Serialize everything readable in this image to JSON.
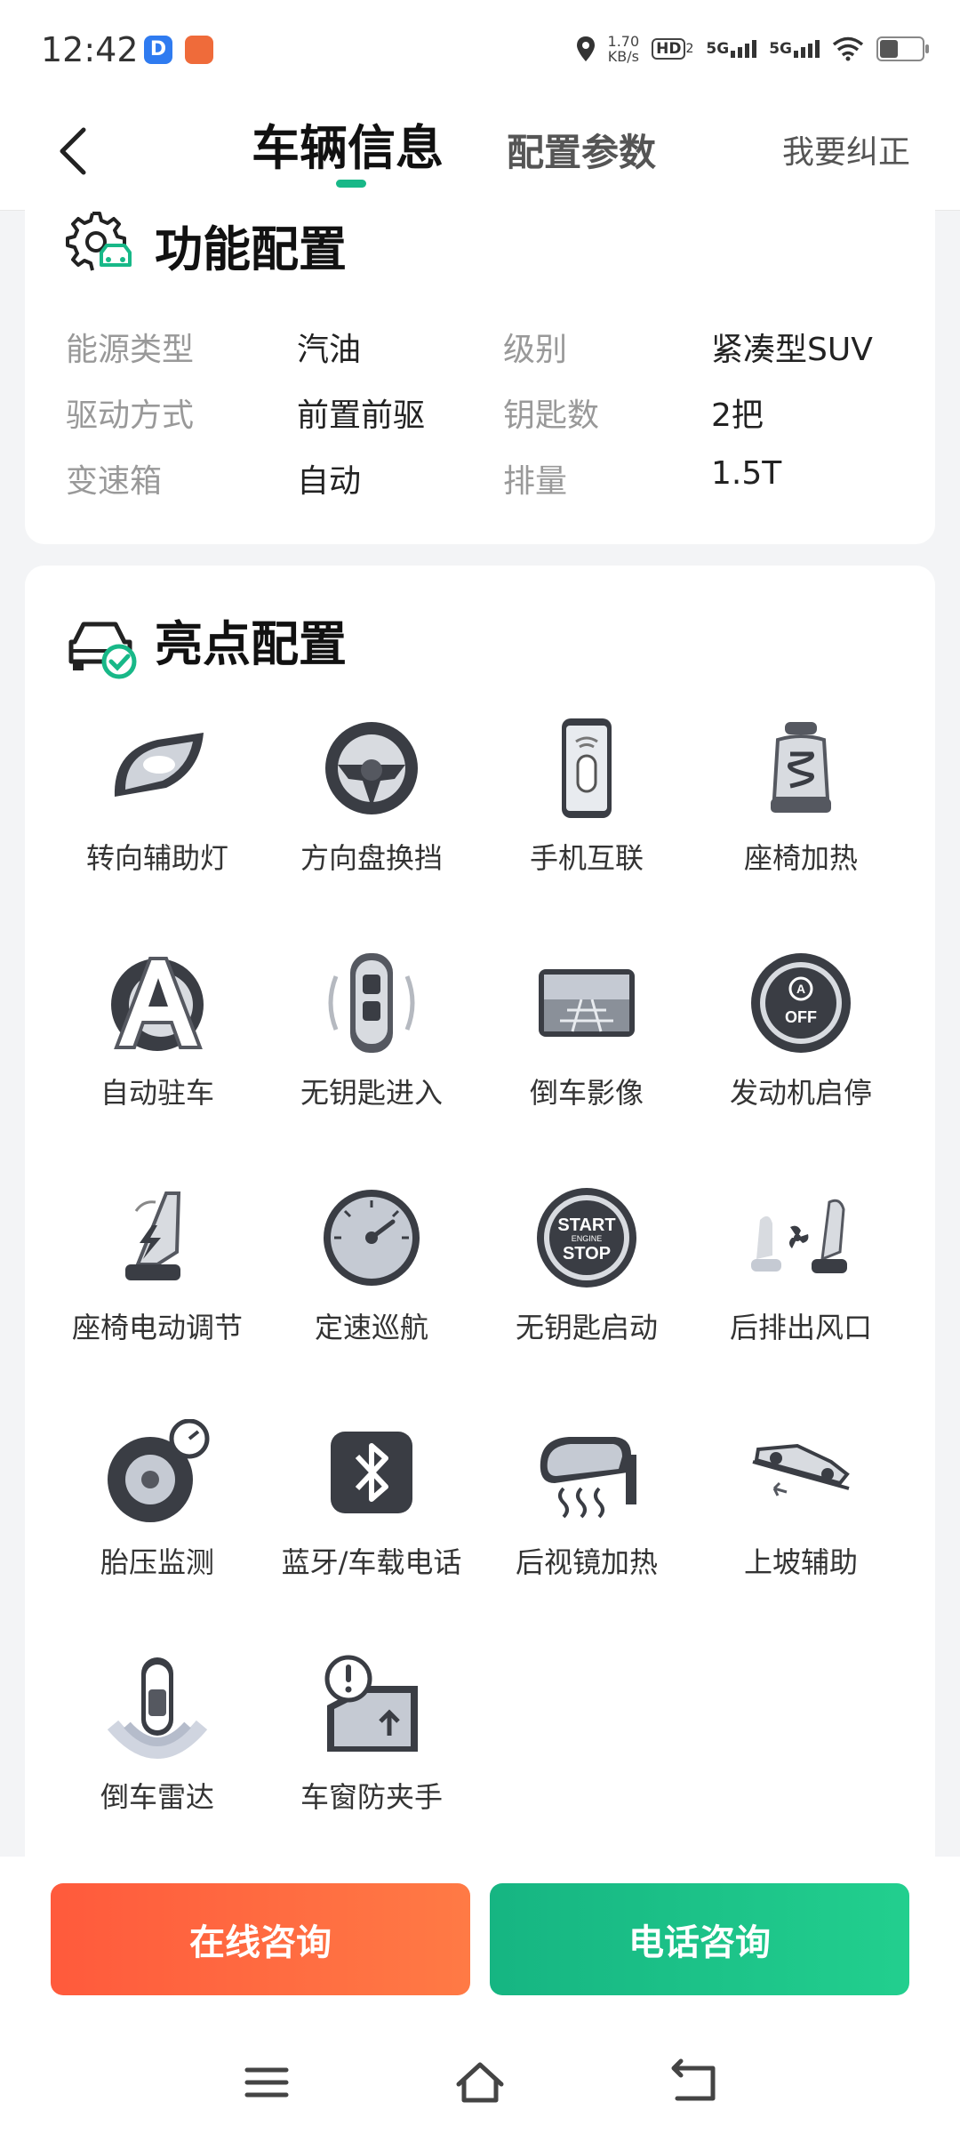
{
  "status_bar": {
    "time": "12:42",
    "speed_value": "1.70",
    "speed_unit": "KB/s",
    "hd_label": "HD",
    "hd_sub": "2",
    "net1": "5G",
    "net2": "5G"
  },
  "nav": {
    "tab_active": "车辆信息",
    "tab_inactive": "配置参数",
    "correct_label": "我要纠正"
  },
  "function_config": {
    "title": "功能配置",
    "rows": [
      {
        "label1": "能源类型",
        "value1": "汽油",
        "label2": "级别",
        "value2": "紧凑型SUV"
      },
      {
        "label1": "驱动方式",
        "value1": "前置前驱",
        "label2": "钥匙数",
        "value2": "2把"
      },
      {
        "label1": "变速箱",
        "value1": "自动",
        "label2": "排量",
        "value2": "1.5T"
      }
    ]
  },
  "highlight_config": {
    "title": "亮点配置",
    "items": [
      {
        "label": "转向辅助灯",
        "icon": "headlight-icon"
      },
      {
        "label": "方向盘换挡",
        "icon": "steering-wheel-icon"
      },
      {
        "label": "手机互联",
        "icon": "phone-link-icon"
      },
      {
        "label": "座椅加热",
        "icon": "seat-heat-icon"
      },
      {
        "label": "自动驻车",
        "icon": "auto-hold-icon"
      },
      {
        "label": "无钥匙进入",
        "icon": "keyless-entry-icon"
      },
      {
        "label": "倒车影像",
        "icon": "reverse-camera-icon"
      },
      {
        "label": "发动机启停",
        "icon": "engine-start-stop-icon"
      },
      {
        "label": "座椅电动调节",
        "icon": "power-seat-icon"
      },
      {
        "label": "定速巡航",
        "icon": "cruise-control-icon"
      },
      {
        "label": "无钥匙启动",
        "icon": "start-button-icon"
      },
      {
        "label": "后排出风口",
        "icon": "rear-vent-icon"
      },
      {
        "label": "胎压监测",
        "icon": "tire-pressure-icon"
      },
      {
        "label": "蓝牙/车载电话",
        "icon": "bluetooth-icon"
      },
      {
        "label": "后视镜加热",
        "icon": "mirror-heat-icon"
      },
      {
        "label": "上坡辅助",
        "icon": "hill-assist-icon"
      },
      {
        "label": "倒车雷达",
        "icon": "parking-radar-icon"
      },
      {
        "label": "车窗防夹手",
        "icon": "window-anti-pinch-icon"
      }
    ],
    "start_button": {
      "line1": "START",
      "line2": "ENGINE",
      "line3": "STOP"
    },
    "off_label": "OFF"
  },
  "actions": {
    "online": "在线咨询",
    "phone": "电话咨询"
  },
  "colors": {
    "accent_green": "#18b888",
    "accent_orange": "#ff5a3c"
  }
}
